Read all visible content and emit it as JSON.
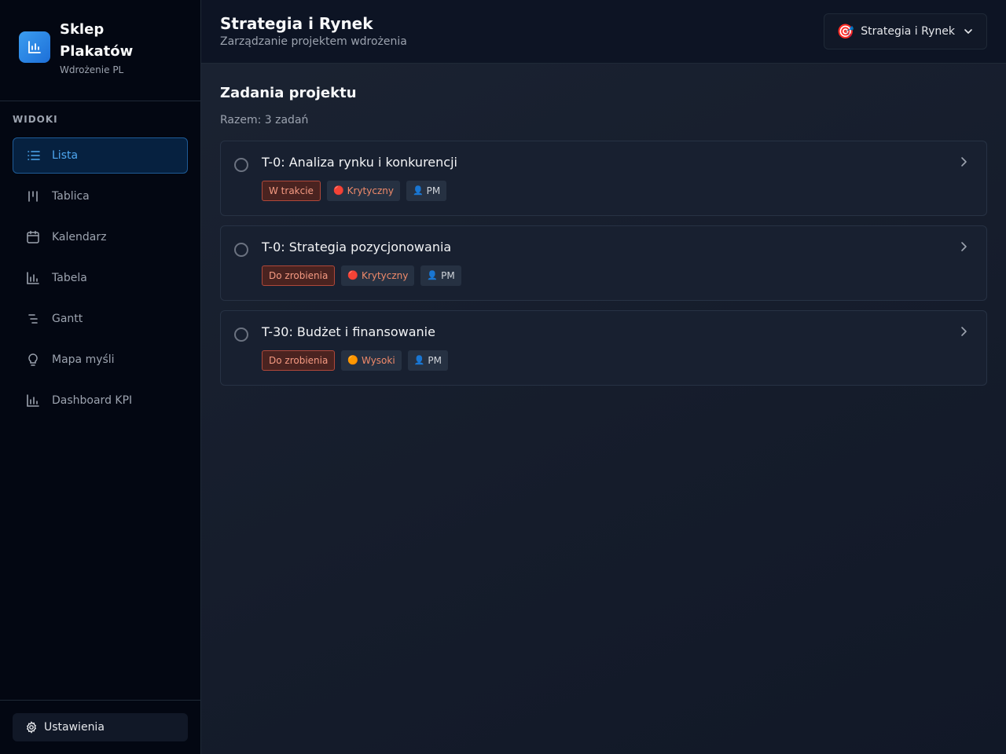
{
  "brand": {
    "name": "Sklep Plakatów",
    "subtitle": "Wdrożenie PL"
  },
  "nav": {
    "heading": "WIDOKI",
    "items": [
      {
        "label": "Lista",
        "icon": "list-icon",
        "active": true
      },
      {
        "label": "Tablica",
        "icon": "board-icon",
        "active": false
      },
      {
        "label": "Kalendarz",
        "icon": "calendar-icon",
        "active": false
      },
      {
        "label": "Tabela",
        "icon": "table-icon",
        "active": false
      },
      {
        "label": "Gantt",
        "icon": "gantt-icon",
        "active": false
      },
      {
        "label": "Mapa myśli",
        "icon": "lightbulb-icon",
        "active": false
      },
      {
        "label": "Dashboard KPI",
        "icon": "chart-icon",
        "active": false
      }
    ],
    "settings_label": "Ustawienia"
  },
  "header": {
    "title": "Strategia i Rynek",
    "subtitle": "Zarządzanie projektem wdrożenia",
    "project_select": {
      "emoji": "🎯",
      "label": "Strategia i Rynek"
    }
  },
  "content": {
    "title": "Zadania projektu",
    "count": "Razem: 3 zadań",
    "tasks": [
      {
        "title": "T-0: Analiza rynku i konkurencji",
        "status": "W trakcie",
        "priority": "Krytyczny",
        "priority_dot": "🔴",
        "owner": "PM",
        "owner_icon": "👤"
      },
      {
        "title": "T-0: Strategia pozycjonowania",
        "status": "Do zrobienia",
        "priority": "Krytyczny",
        "priority_dot": "🔴",
        "owner": "PM",
        "owner_icon": "👤"
      },
      {
        "title": "T-30: Budżet i finansowanie",
        "status": "Do zrobienia",
        "priority": "Wysoki",
        "priority_dot": "🟠",
        "owner": "PM",
        "owner_icon": "👤"
      }
    ]
  },
  "colors": {
    "accent": "#4ea7f0",
    "status_border": "#b0483a",
    "priority_text": "#f08a6a"
  }
}
